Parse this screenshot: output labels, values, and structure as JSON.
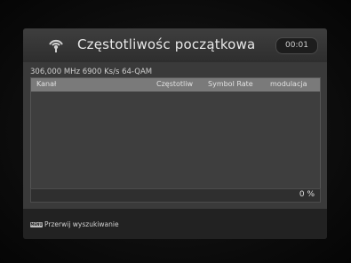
{
  "header": {
    "title": "Częstotliwośc początkowa",
    "clock": "00:01",
    "icon": "satellite-dish-icon"
  },
  "scan": {
    "parameters": "306,000 MHz  6900 Ks/s  64-QAM"
  },
  "table": {
    "columns": [
      "Kanał",
      "Częstotliw",
      "Symbol Rate",
      "modulacja"
    ]
  },
  "progress": {
    "label": "0 %",
    "fraction": 0
  },
  "footer": {
    "key_label": "MENU",
    "hint": "Przerwij wyszukiwanie"
  }
}
